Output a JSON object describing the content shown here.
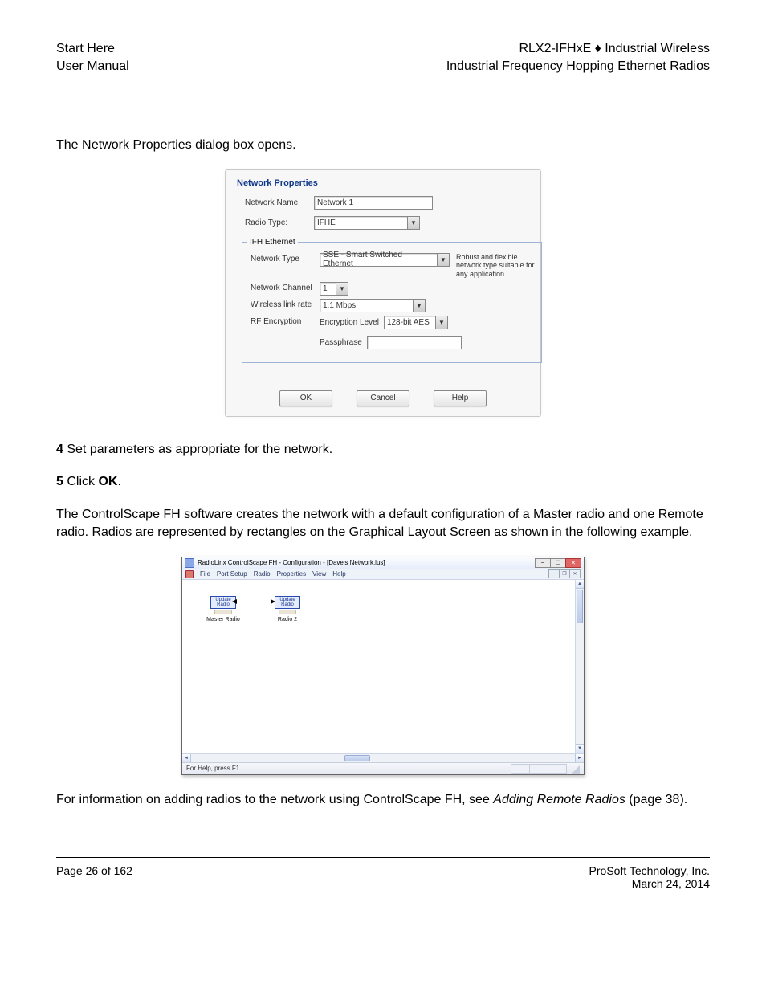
{
  "header": {
    "left_line1": "Start Here",
    "left_line2": "User Manual",
    "right_line1_product": "RLX2-IFHxE",
    "right_line1_sep": " ♦ ",
    "right_line1_tag": "Industrial Wireless",
    "right_line2": "Industrial Frequency Hopping Ethernet Radios"
  },
  "intro": {
    "p1_pre": "The ",
    "p1_small1": "N",
    "p1_small2": "etwork ",
    "p1_small3": "P",
    "p1_small4": "roperties",
    "p1_post": " dialog box opens."
  },
  "dialog1": {
    "title": "Network Properties",
    "network_name_label": "Network Name",
    "network_name_value": "Network 1",
    "radio_type_label": "Radio Type:",
    "radio_type_value": "IFHE",
    "fieldset_legend": "IFH Ethernet",
    "network_type_label": "Network Type",
    "network_type_value": "SSE - Smart Switched Ethernet",
    "network_type_hint": "Robust and flexible network type suitable for any application.",
    "network_channel_label": "Network Channel",
    "network_channel_value": "1",
    "wireless_rate_label": "Wireless link rate",
    "wireless_rate_value": "1.1 Mbps",
    "rf_encryption_label": "RF Encryption",
    "encryption_level_label": "Encryption Level",
    "encryption_level_value": "128-bit AES",
    "passphrase_label": "Passphrase",
    "passphrase_value": "",
    "btn_ok": "OK",
    "btn_cancel": "Cancel",
    "btn_help": "Help"
  },
  "mid_text": {
    "step4_num": "4",
    "step4": "    Set parameters as appropriate for the network.",
    "step5_num": "5",
    "step5_pre": "    Click ",
    "step5_btn": "OK",
    "step5_post": "."
  },
  "mid_paragraph": "The ControlScape FH software creates the network with a default configuration of a Master radio and one Remote radio. Radios are represented by rectangles on the Graphical Layout Screen as shown in the following example.",
  "appwin": {
    "title": "RadioLinx ControlScape FH - Configuration - [Dave's Network.lus]",
    "menu": [
      "File",
      "Port Setup",
      "Radio",
      "Properties",
      "View",
      "Help"
    ],
    "status": "For Help, press F1",
    "nodes": {
      "master": {
        "box": "Update Radio",
        "label": "Master Radio"
      },
      "remote": {
        "box": "Update Radio",
        "label": "Radio 2"
      }
    }
  },
  "outro": {
    "p_pre": "For information on adding radios to the network using ControlScape FH, see ",
    "p_ital": "Adding Remote Radios",
    "p_post": " (page 38)."
  },
  "footer": {
    "left_line1": "Page 26 of 162",
    "right_line1": "ProSoft Technology, Inc.",
    "right_line2": "March 24, 2014"
  }
}
